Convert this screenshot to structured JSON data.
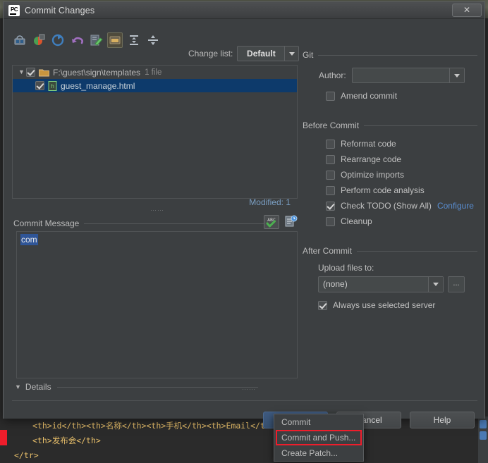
{
  "window": {
    "title": "Commit Changes",
    "app_icon": "pycharm-icon",
    "close_label": "✕"
  },
  "toolbar": {
    "icons": [
      {
        "name": "show-diff-icon",
        "title": "Show Diff"
      },
      {
        "name": "revert-refresh-icon",
        "title": "Refresh Changes"
      },
      {
        "name": "rollback-refresh-icon",
        "title": "Rollback"
      },
      {
        "name": "undo-icon",
        "title": "Revert"
      },
      {
        "name": "edit-source-icon",
        "title": "Edit Source"
      },
      {
        "name": "group-by-directory-icon",
        "title": "Group By Directory",
        "selected": true
      },
      {
        "name": "expand-all-icon",
        "title": "Expand All"
      },
      {
        "name": "collapse-all-icon",
        "title": "Collapse All"
      }
    ],
    "changelist_label": "Change list:",
    "changelist_value": "Default"
  },
  "filetree": {
    "folder_row": {
      "path": "F:\\guest\\sign\\templates",
      "count": "1 file",
      "checked": true,
      "expanded": true
    },
    "file_row": {
      "name": "guest_manage.html",
      "checked": true,
      "selected": true
    }
  },
  "status": {
    "modified_label": "Modified: 1"
  },
  "commit_message": {
    "title": "Commit Message",
    "title_mnemonic": "C",
    "value": "com",
    "spellcheck_icon": "abc-spellcheck-icon",
    "history_icon": "message-history-icon"
  },
  "details": {
    "label": "Details",
    "expanded": true
  },
  "git": {
    "group_title": "Git",
    "author_label": "Author:",
    "author_mnemonic": "A",
    "author_value": "",
    "amend_label": "Amend commit",
    "amend_mnemonic": "m",
    "amend_checked": false
  },
  "before_commit": {
    "group_title": "Before Commit",
    "items": [
      {
        "label": "Reformat code",
        "mnemonic": "R",
        "checked": false
      },
      {
        "label": "Rearrange code",
        "mnemonic": "n",
        "checked": false
      },
      {
        "label": "Optimize imports",
        "mnemonic": "O",
        "checked": false
      },
      {
        "label": "Perform code analysis",
        "mnemonic": "y",
        "checked": false
      },
      {
        "label": "Check TODO (Show All)",
        "mnemonic": "",
        "checked": true,
        "link": "Configure"
      },
      {
        "label": "Cleanup",
        "mnemonic": "l",
        "checked": false
      }
    ]
  },
  "after_commit": {
    "group_title": "After Commit",
    "upload_label": "Upload files to:",
    "upload_value": "(none)",
    "ellipsis_label": "...",
    "always_label": "Always use selected server",
    "always_checked": true
  },
  "footer": {
    "commit_label": "Commit",
    "commit_mnemonic": "t",
    "cancel_label": "Cancel",
    "help_label": "Help"
  },
  "popup_menu": {
    "items": [
      {
        "label": "Commit",
        "mnemonic": "i",
        "highlighted": false
      },
      {
        "label": "Commit and Push...",
        "mnemonic": "P",
        "highlighted": true
      },
      {
        "label": "Create Patch...",
        "mnemonic": "",
        "highlighted": false
      }
    ]
  },
  "editor_background": {
    "lines": [
      "<th>id</th><th>名称</th><th>手机</th><th>Email</th><th>签",
      "<th>发布会</th>",
      "</tr>"
    ]
  },
  "colors": {
    "accent_blue": "#598dd0",
    "selection_blue": "#0d3a6b",
    "highlight_red": "#ef1d2b",
    "dialog_bg": "#3c3f41",
    "editor_bg": "#2b2b2b"
  }
}
